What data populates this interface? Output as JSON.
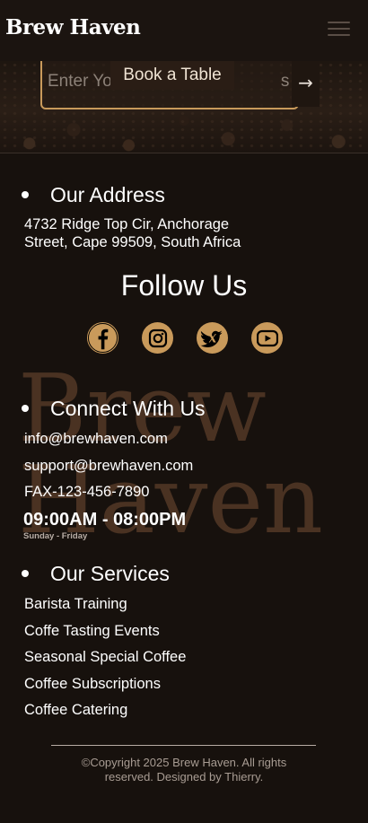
{
  "navbar": {
    "brand": "Brew Haven",
    "menu_icon": "hamburger-menu-icon"
  },
  "hero": {
    "email_placeholder": "Enter Your Email Address",
    "email_visible_fragments": [
      "Enter Yo",
      "s"
    ],
    "book_table_label": "Book a Table",
    "submit_arrow": "→"
  },
  "address": {
    "title": "Our Address",
    "lines": [
      "4732 Ridge Top Cir, Anchorage",
      "Street, Cape 99509, South Africa"
    ]
  },
  "follow": {
    "title": "Follow Us",
    "icons": [
      "facebook-icon",
      "instagram-icon",
      "twitter-icon",
      "youtube-icon"
    ]
  },
  "connect": {
    "title": "Connect With Us",
    "items": [
      "info@brewhaven.com",
      "support@brewhaven.com",
      "FAX-123-456-7890"
    ],
    "hours": "09:00AM - 08:00PM",
    "days": "Sunday - Friday"
  },
  "watermark": [
    "Brew",
    "Haven"
  ],
  "services": {
    "title": "Our Services",
    "items": [
      "Barista Training",
      "Coffe Tasting Events",
      "Seasonal Special Coffee",
      "Coffee Subscriptions",
      "Coffee Catering"
    ]
  },
  "footer": {
    "copyright": "©Copyright 2025 Brew Haven. All rights reserved. Designed by Thierry."
  },
  "colors": {
    "background": "#17110d",
    "accent": "#c99a5b",
    "watermark": "#4a3222"
  }
}
